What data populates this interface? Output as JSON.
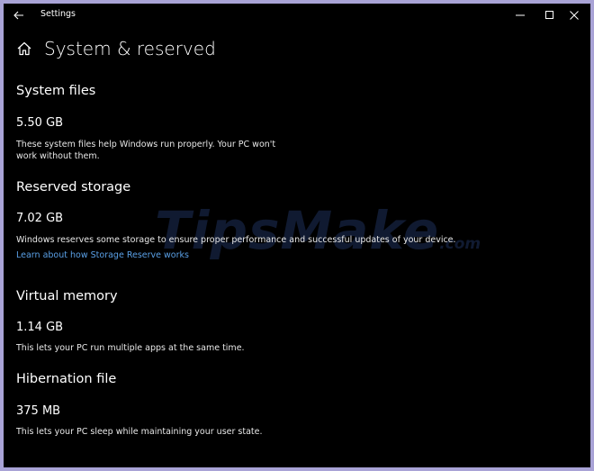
{
  "window": {
    "title": "Settings",
    "back_icon": "back-arrow-icon",
    "controls": [
      "minimize-icon",
      "maximize-icon",
      "close-icon"
    ]
  },
  "page": {
    "title": "System & reserved",
    "icon": "home-icon"
  },
  "sections": {
    "system_files": {
      "title": "System files",
      "size": "5.50 GB",
      "description": "These system files help Windows run properly. Your PC won't work without them."
    },
    "reserved_storage": {
      "title": "Reserved storage",
      "size": "7.02 GB",
      "description": "Windows reserves some storage to ensure proper performance and successful updates of your device.",
      "link": "Learn about how Storage Reserve works"
    },
    "virtual_memory": {
      "title": "Virtual memory",
      "size": "1.14 GB",
      "description": "This lets your PC run multiple apps at the same time."
    },
    "hibernation_file": {
      "title": "Hibernation file",
      "size": "375 MB",
      "description": "This lets your PC sleep while maintaining your user state."
    }
  },
  "watermark": {
    "text": "TipsMake",
    "suffix": ".com"
  },
  "colors": {
    "background": "#000000",
    "text": "#ffffff",
    "link": "#5aa0e6",
    "frame_border": "#a9a3d6"
  }
}
